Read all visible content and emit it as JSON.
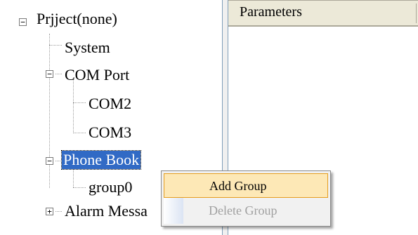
{
  "tree": {
    "nodes": [
      {
        "label": "Prjject(none)",
        "expander": "minus"
      },
      {
        "label": "System"
      },
      {
        "label": "COM Port",
        "expander": "minus"
      },
      {
        "label": "COM2"
      },
      {
        "label": "COM3"
      },
      {
        "label": "Phone Book",
        "expander": "minus",
        "selected": true
      },
      {
        "label": "group0"
      },
      {
        "label": "Alarm Messa",
        "expander": "plus"
      }
    ]
  },
  "parameters": {
    "header": "Parameters"
  },
  "context_menu": {
    "items": [
      {
        "label": "Add Group",
        "state": "hover"
      },
      {
        "label": "Delete Group",
        "state": "disabled"
      }
    ]
  },
  "colors": {
    "selection": "#316ac5",
    "menu_hover_fill": "#fde8b6",
    "menu_hover_border": "#e59d1f",
    "header_fill": "#ece9d8"
  }
}
